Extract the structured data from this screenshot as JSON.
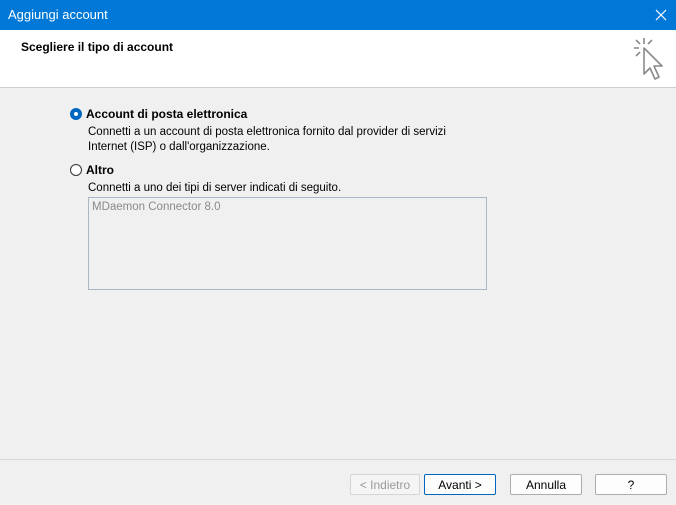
{
  "window": {
    "title": "Aggiungi account"
  },
  "header": {
    "heading": "Scegliere il tipo di account"
  },
  "options": [
    {
      "label": "Account di posta elettronica",
      "selected": true,
      "description_line1": "Connetti a un account di posta elettronica fornito dal provider di servizi",
      "description_line2": "Internet (ISP) o dall'organizzazione."
    },
    {
      "label": "Altro",
      "selected": false,
      "description_line1": "Connetti a uno dei tipi di server indicati di seguito."
    }
  ],
  "server_list": {
    "items": [
      "MDaemon Connector 8.0"
    ]
  },
  "buttons": {
    "back": "< Indietro",
    "next": "Avanti >",
    "cancel": "Annulla",
    "help": "?"
  },
  "colors": {
    "titlebar": "#0078d7",
    "accent": "#0067c0"
  }
}
